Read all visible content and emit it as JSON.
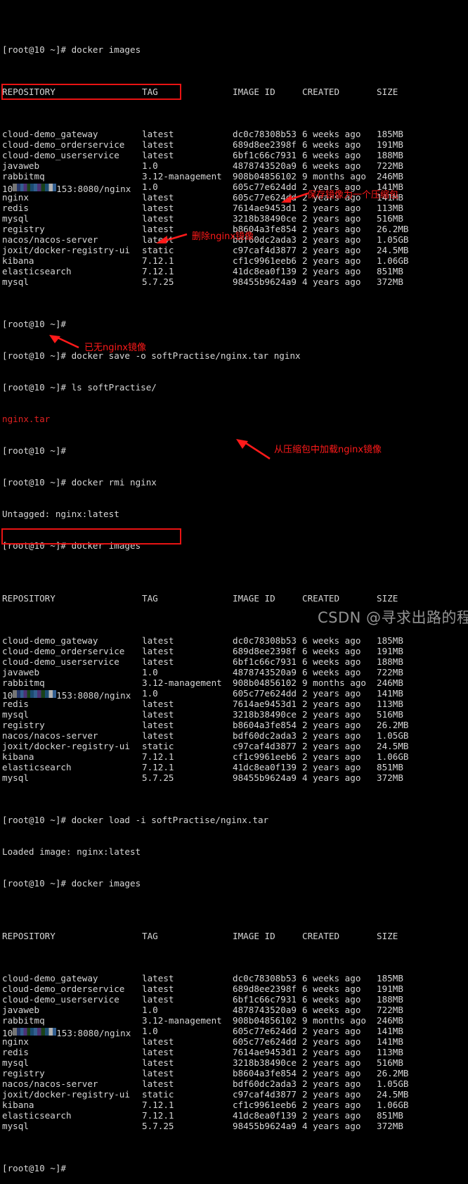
{
  "terminal": {
    "prompt": "[root@10 ~]# ",
    "columns": [
      "REPOSITORY",
      "TAG",
      "IMAGE ID",
      "CREATED",
      "SIZE"
    ],
    "censored_repo_suffix": ":8080/nginx",
    "commands": {
      "docker_images": "docker images",
      "docker_save": "docker save -o softPractise/nginx.tar nginx",
      "ls_softpractise": "ls softPractise/",
      "docker_rmi": "docker rmi nginx",
      "docker_load": "docker load -i softPractise/nginx.tar"
    },
    "outputs": {
      "ls_result": "nginx.tar",
      "untagged": "Untagged: nginx:latest",
      "loaded": "Loaded image: nginx:latest"
    },
    "table1": [
      {
        "repo": "cloud-demo_gateway",
        "tag": "latest",
        "id": "dc0c78308b53",
        "created": "6 weeks ago",
        "size": "185MB"
      },
      {
        "repo": "cloud-demo_orderservice",
        "tag": "latest",
        "id": "689d8ee2398f",
        "created": "6 weeks ago",
        "size": "191MB"
      },
      {
        "repo": "cloud-demo_userservice",
        "tag": "latest",
        "id": "6bf1c66c7931",
        "created": "6 weeks ago",
        "size": "188MB"
      },
      {
        "repo": "javaweb",
        "tag": "1.0",
        "id": "4878743520a9",
        "created": "6 weeks ago",
        "size": "722MB"
      },
      {
        "repo": "rabbitmq",
        "tag": "3.12-management",
        "id": "908b04856102",
        "created": "9 months ago",
        "size": "246MB"
      },
      {
        "repo": "__CENSORED__",
        "tag": "1.0",
        "id": "605c77e624dd",
        "created": "2 years ago",
        "size": "141MB"
      },
      {
        "repo": "nginx",
        "tag": "latest",
        "id": "605c77e624dd",
        "created": "2 years ago",
        "size": "141MB"
      },
      {
        "repo": "redis",
        "tag": "latest",
        "id": "7614ae9453d1",
        "created": "2 years ago",
        "size": "113MB"
      },
      {
        "repo": "mysql",
        "tag": "latest",
        "id": "3218b38490ce",
        "created": "2 years ago",
        "size": "516MB"
      },
      {
        "repo": "registry",
        "tag": "latest",
        "id": "b8604a3fe854",
        "created": "2 years ago",
        "size": "26.2MB"
      },
      {
        "repo": "nacos/nacos-server",
        "tag": "latest",
        "id": "bdf60dc2ada3",
        "created": "2 years ago",
        "size": "1.05GB"
      },
      {
        "repo": "joxit/docker-registry-ui",
        "tag": "static",
        "id": "c97caf4d3877",
        "created": "2 years ago",
        "size": "24.5MB"
      },
      {
        "repo": "kibana",
        "tag": "7.12.1",
        "id": "cf1c9961eeb6",
        "created": "2 years ago",
        "size": "1.06GB"
      },
      {
        "repo": "elasticsearch",
        "tag": "7.12.1",
        "id": "41dc8ea0f139",
        "created": "2 years ago",
        "size": "851MB"
      },
      {
        "repo": "mysql",
        "tag": "5.7.25",
        "id": "98455b9624a9",
        "created": "4 years ago",
        "size": "372MB"
      }
    ],
    "table2": [
      {
        "repo": "cloud-demo_gateway",
        "tag": "latest",
        "id": "dc0c78308b53",
        "created": "6 weeks ago",
        "size": "185MB"
      },
      {
        "repo": "cloud-demo_orderservice",
        "tag": "latest",
        "id": "689d8ee2398f",
        "created": "6 weeks ago",
        "size": "191MB"
      },
      {
        "repo": "cloud-demo_userservice",
        "tag": "latest",
        "id": "6bf1c66c7931",
        "created": "6 weeks ago",
        "size": "188MB"
      },
      {
        "repo": "javaweb",
        "tag": "1.0",
        "id": "4878743520a9",
        "created": "6 weeks ago",
        "size": "722MB"
      },
      {
        "repo": "rabbitmq",
        "tag": "3.12-management",
        "id": "908b04856102",
        "created": "9 months ago",
        "size": "246MB"
      },
      {
        "repo": "__CENSORED__",
        "tag": "1.0",
        "id": "605c77e624dd",
        "created": "2 years ago",
        "size": "141MB"
      },
      {
        "repo": "redis",
        "tag": "latest",
        "id": "7614ae9453d1",
        "created": "2 years ago",
        "size": "113MB"
      },
      {
        "repo": "mysql",
        "tag": "latest",
        "id": "3218b38490ce",
        "created": "2 years ago",
        "size": "516MB"
      },
      {
        "repo": "registry",
        "tag": "latest",
        "id": "b8604a3fe854",
        "created": "2 years ago",
        "size": "26.2MB"
      },
      {
        "repo": "nacos/nacos-server",
        "tag": "latest",
        "id": "bdf60dc2ada3",
        "created": "2 years ago",
        "size": "1.05GB"
      },
      {
        "repo": "joxit/docker-registry-ui",
        "tag": "static",
        "id": "c97caf4d3877",
        "created": "2 years ago",
        "size": "24.5MB"
      },
      {
        "repo": "kibana",
        "tag": "7.12.1",
        "id": "cf1c9961eeb6",
        "created": "2 years ago",
        "size": "1.06GB"
      },
      {
        "repo": "elasticsearch",
        "tag": "7.12.1",
        "id": "41dc8ea0f139",
        "created": "2 years ago",
        "size": "851MB"
      },
      {
        "repo": "mysql",
        "tag": "5.7.25",
        "id": "98455b9624a9",
        "created": "4 years ago",
        "size": "372MB"
      }
    ],
    "table3": [
      {
        "repo": "cloud-demo_gateway",
        "tag": "latest",
        "id": "dc0c78308b53",
        "created": "6 weeks ago",
        "size": "185MB"
      },
      {
        "repo": "cloud-demo_orderservice",
        "tag": "latest",
        "id": "689d8ee2398f",
        "created": "6 weeks ago",
        "size": "191MB"
      },
      {
        "repo": "cloud-demo_userservice",
        "tag": "latest",
        "id": "6bf1c66c7931",
        "created": "6 weeks ago",
        "size": "188MB"
      },
      {
        "repo": "javaweb",
        "tag": "1.0",
        "id": "4878743520a9",
        "created": "6 weeks ago",
        "size": "722MB"
      },
      {
        "repo": "rabbitmq",
        "tag": "3.12-management",
        "id": "908b04856102",
        "created": "9 months ago",
        "size": "246MB"
      },
      {
        "repo": "__CENSORED__",
        "tag": "1.0",
        "id": "605c77e624dd",
        "created": "2 years ago",
        "size": "141MB"
      },
      {
        "repo": "nginx",
        "tag": "latest",
        "id": "605c77e624dd",
        "created": "2 years ago",
        "size": "141MB"
      },
      {
        "repo": "redis",
        "tag": "latest",
        "id": "7614ae9453d1",
        "created": "2 years ago",
        "size": "113MB"
      },
      {
        "repo": "mysql",
        "tag": "latest",
        "id": "3218b38490ce",
        "created": "2 years ago",
        "size": "516MB"
      },
      {
        "repo": "registry",
        "tag": "latest",
        "id": "b8604a3fe854",
        "created": "2 years ago",
        "size": "26.2MB"
      },
      {
        "repo": "nacos/nacos-server",
        "tag": "latest",
        "id": "bdf60dc2ada3",
        "created": "2 years ago",
        "size": "1.05GB"
      },
      {
        "repo": "joxit/docker-registry-ui",
        "tag": "static",
        "id": "c97caf4d3877",
        "created": "2 years ago",
        "size": "24.5MB"
      },
      {
        "repo": "kibana",
        "tag": "7.12.1",
        "id": "cf1c9961eeb6",
        "created": "2 years ago",
        "size": "1.06GB"
      },
      {
        "repo": "elasticsearch",
        "tag": "7.12.1",
        "id": "41dc8ea0f139",
        "created": "2 years ago",
        "size": "851MB"
      },
      {
        "repo": "mysql",
        "tag": "5.7.25",
        "id": "98455b9624a9",
        "created": "4 years ago",
        "size": "372MB"
      }
    ]
  },
  "annotations": {
    "save": "保存镜像为一个压缩包",
    "rmi": "删除nginx镜像",
    "gone": "已无nginx镜像",
    "load": "从压缩包中加载nginx镜像"
  },
  "watermark": "CSDN @寻求出路的程序媛",
  "colors": {
    "background": "#000000",
    "text": "#d6d6d6",
    "annotation_red": "#ff1a1a",
    "box_red": "#e81313",
    "output_red": "#e02020"
  }
}
